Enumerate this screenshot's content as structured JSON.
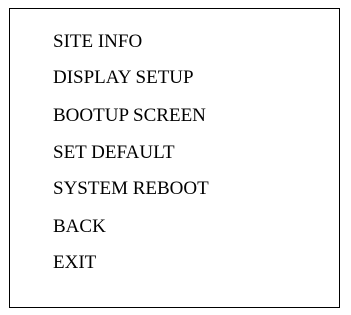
{
  "menu": {
    "items": [
      {
        "label": "SITE INFO"
      },
      {
        "label": "DISPLAY SETUP"
      },
      {
        "label": "BOOTUP SCREEN"
      },
      {
        "label": "SET DEFAULT"
      },
      {
        "label": "SYSTEM REBOOT"
      },
      {
        "label": "BACK"
      },
      {
        "label": "EXIT"
      }
    ]
  }
}
